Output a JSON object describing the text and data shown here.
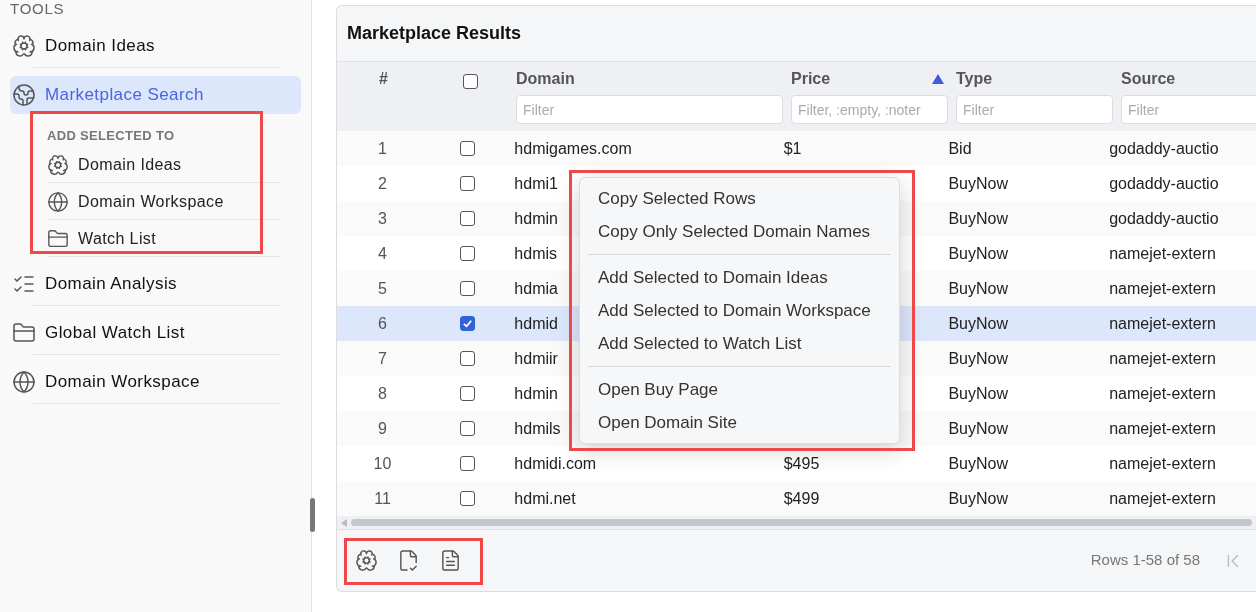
{
  "sidebar": {
    "section_title": "TOOLS",
    "items": [
      {
        "label": "Domain Ideas",
        "selected": false
      },
      {
        "label": "Marketplace Search",
        "selected": true,
        "submenu": {
          "title": "ADD SELECTED TO",
          "items": [
            {
              "label": "Domain Ideas"
            },
            {
              "label": "Domain Workspace"
            },
            {
              "label": "Watch List"
            }
          ]
        }
      },
      {
        "label": "Domain Analysis",
        "selected": false
      },
      {
        "label": "Global Watch List",
        "selected": false
      },
      {
        "label": "Domain Workspace",
        "selected": false
      }
    ]
  },
  "results": {
    "title": "Marketplace Results",
    "columns": [
      {
        "label": "#"
      },
      {
        "kind": "checkbox",
        "checked": false
      },
      {
        "label": "Domain",
        "placeholder": "Filter"
      },
      {
        "label": "Price",
        "placeholder": "Filter, :empty, :noter",
        "sorted": true
      },
      {
        "label": "Type",
        "placeholder": "Filter"
      },
      {
        "label": "Source",
        "placeholder": "Filter"
      }
    ],
    "rows": [
      {
        "index": "1",
        "selected": false,
        "domain": "hdmigames.com",
        "price": "$1",
        "type": "Bid",
        "source": "godaddy-auctio"
      },
      {
        "index": "2",
        "selected": false,
        "domain": "hdmi1",
        "type": "BuyNow",
        "source": "godaddy-auctio"
      },
      {
        "index": "3",
        "selected": false,
        "domain": "hdmin",
        "type": "BuyNow",
        "source": "godaddy-auctio"
      },
      {
        "index": "4",
        "selected": false,
        "domain": "hdmis",
        "type": "BuyNow",
        "source": "namejet-extern"
      },
      {
        "index": "5",
        "selected": false,
        "domain": "hdmia",
        "type": "BuyNow",
        "source": "namejet-extern"
      },
      {
        "index": "6",
        "selected": true,
        "domain": "hdmid",
        "type": "BuyNow",
        "source": "namejet-extern"
      },
      {
        "index": "7",
        "selected": false,
        "domain": "hdmiir",
        "type": "BuyNow",
        "source": "namejet-extern"
      },
      {
        "index": "8",
        "selected": false,
        "domain": "hdmin",
        "type": "BuyNow",
        "source": "namejet-extern"
      },
      {
        "index": "9",
        "selected": false,
        "domain": "hdmils",
        "type": "BuyNow",
        "source": "namejet-extern"
      },
      {
        "index": "10",
        "selected": false,
        "domain": "hdmidi.com",
        "price": "$495",
        "type": "BuyNow",
        "source": "namejet-extern"
      },
      {
        "index": "11",
        "selected": false,
        "domain": "hdmi.net",
        "price": "$499",
        "type": "BuyNow",
        "source": "namejet-extern"
      }
    ],
    "footer": {
      "row_count": "Rows 1-58 of 58"
    }
  },
  "context_menu": {
    "groups": [
      [
        "Copy Selected Rows",
        "Copy Only Selected Domain Names"
      ],
      [
        "Add Selected to Domain Ideas",
        "Add Selected to Domain Workspace",
        "Add Selected to Watch List"
      ],
      [
        "Open Buy Page",
        "Open Domain Site"
      ]
    ]
  }
}
